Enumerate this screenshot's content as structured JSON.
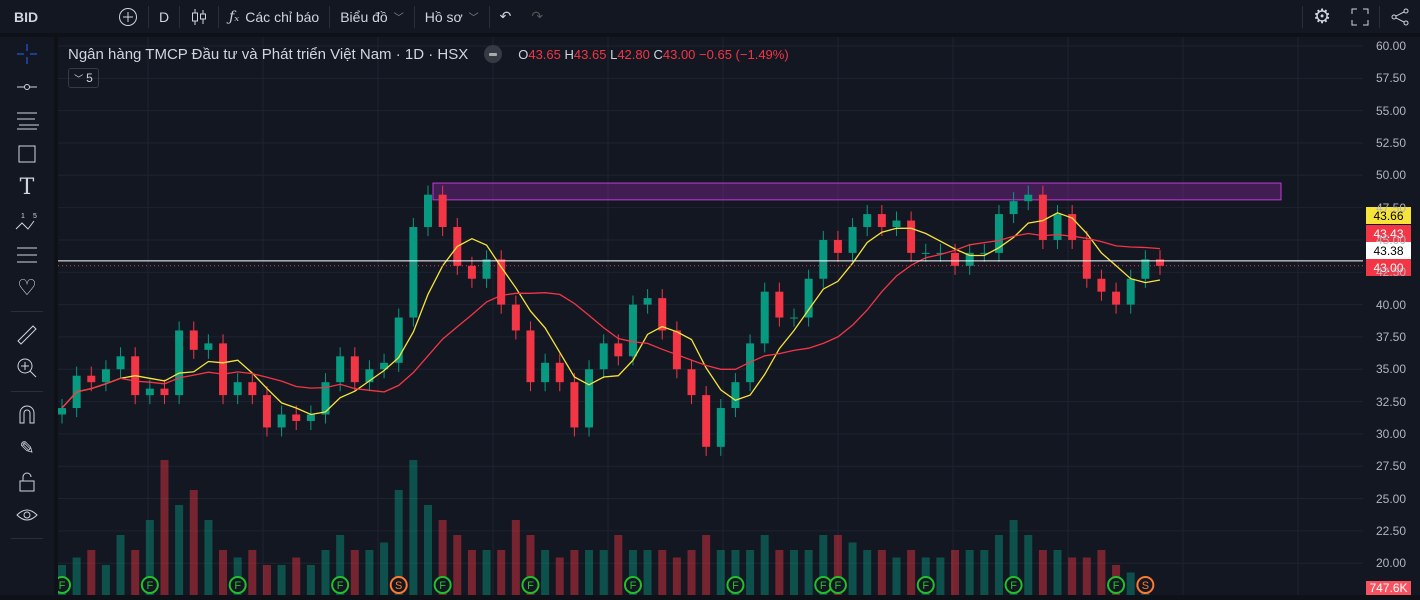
{
  "toolbar": {
    "symbol": "BID",
    "interval": "D",
    "indicators_label": "Các chỉ báo",
    "chart_label": "Biểu đồ",
    "profile_label": "Hồ sơ"
  },
  "legend": {
    "title": "Ngân hàng TMCP Đầu tư và Phát triển Việt Nam · 1D · HSX",
    "o_label": "O",
    "o": "43.65",
    "h_label": "H",
    "h": "43.65",
    "l_label": "L",
    "l": "42.80",
    "c_label": "C",
    "c": "43.00",
    "change": "−0.65 (−1.49%)",
    "collapse_count": "5"
  },
  "price_labels": {
    "ma_fast": "43.66",
    "ma_slow": "43.43",
    "line": "43.38",
    "last": "43.00",
    "volume": "747.6K"
  },
  "colors": {
    "up": "#089981",
    "down": "#f23645",
    "ma_fast": "#f7e43a",
    "ma_slow": "#f23645",
    "zone": "#9c27b0",
    "bg": "#131722"
  },
  "chart_data": {
    "type": "candlestick",
    "yticks": [
      "60.00",
      "57.50",
      "55.00",
      "52.50",
      "50.00",
      "47.50",
      "45.00",
      "42.50",
      "40.00",
      "37.50",
      "35.00",
      "32.50",
      "30.00",
      "27.50",
      "25.00",
      "22.50",
      "20.00"
    ],
    "ylim": [
      20,
      60
    ],
    "closes": [
      32,
      34.5,
      34,
      35,
      36,
      33,
      33.5,
      33,
      38,
      36.5,
      37,
      33,
      34,
      33,
      30.5,
      31.5,
      31,
      31.5,
      34,
      36,
      34,
      35,
      35.5,
      39,
      46,
      48.5,
      46,
      43,
      42,
      43.5,
      40,
      38,
      34,
      35.5,
      34,
      30.5,
      35,
      37,
      36,
      40,
      40.5,
      38,
      35,
      33,
      29,
      32,
      34,
      37,
      41,
      39,
      39,
      42,
      45,
      44,
      46,
      47,
      46,
      46.5,
      44,
      44,
      44,
      43,
      44,
      44,
      47,
      48,
      48.5,
      45,
      47,
      45,
      42,
      41,
      40,
      42,
      43.5,
      43
    ],
    "volumes_m": [
      2,
      2.5,
      3,
      2,
      4,
      3,
      5,
      9,
      6,
      7,
      5,
      3,
      2.5,
      3,
      2,
      2,
      2.5,
      2,
      3,
      4,
      3,
      3,
      3.5,
      7,
      9,
      6,
      5,
      4,
      3,
      3,
      3,
      5,
      4,
      3,
      2.5,
      3,
      3,
      3,
      4,
      3,
      3,
      3,
      2.5,
      3,
      4,
      3,
      3,
      3,
      4,
      3,
      3,
      3,
      4,
      4,
      3.5,
      3,
      3,
      2.5,
      3,
      2.5,
      2.5,
      3,
      3,
      3,
      4,
      5,
      4,
      3,
      3,
      2.5,
      2.5,
      3,
      2,
      1.5,
      0.75
    ],
    "hlines": [
      {
        "price": 43.38,
        "style": "solid",
        "color": "#ffffff"
      },
      {
        "price": 43.0,
        "style": "dotted",
        "color": "#f23645"
      }
    ],
    "zone": {
      "top": 49.4,
      "bottom": 48.1
    },
    "events": [
      {
        "t": 0,
        "k": "F"
      },
      {
        "t": 6,
        "k": "F"
      },
      {
        "t": 12,
        "k": "F"
      },
      {
        "t": 19,
        "k": "F"
      },
      {
        "t": 23,
        "k": "S"
      },
      {
        "t": 26,
        "k": "F"
      },
      {
        "t": 32,
        "k": "F"
      },
      {
        "t": 39,
        "k": "F"
      },
      {
        "t": 46,
        "k": "F"
      },
      {
        "t": 52,
        "k": "F"
      },
      {
        "t": 53,
        "k": "F"
      },
      {
        "t": 59,
        "k": "F"
      },
      {
        "t": 65,
        "k": "F"
      },
      {
        "t": 72,
        "k": "F"
      },
      {
        "t": 74,
        "k": "S"
      }
    ]
  }
}
